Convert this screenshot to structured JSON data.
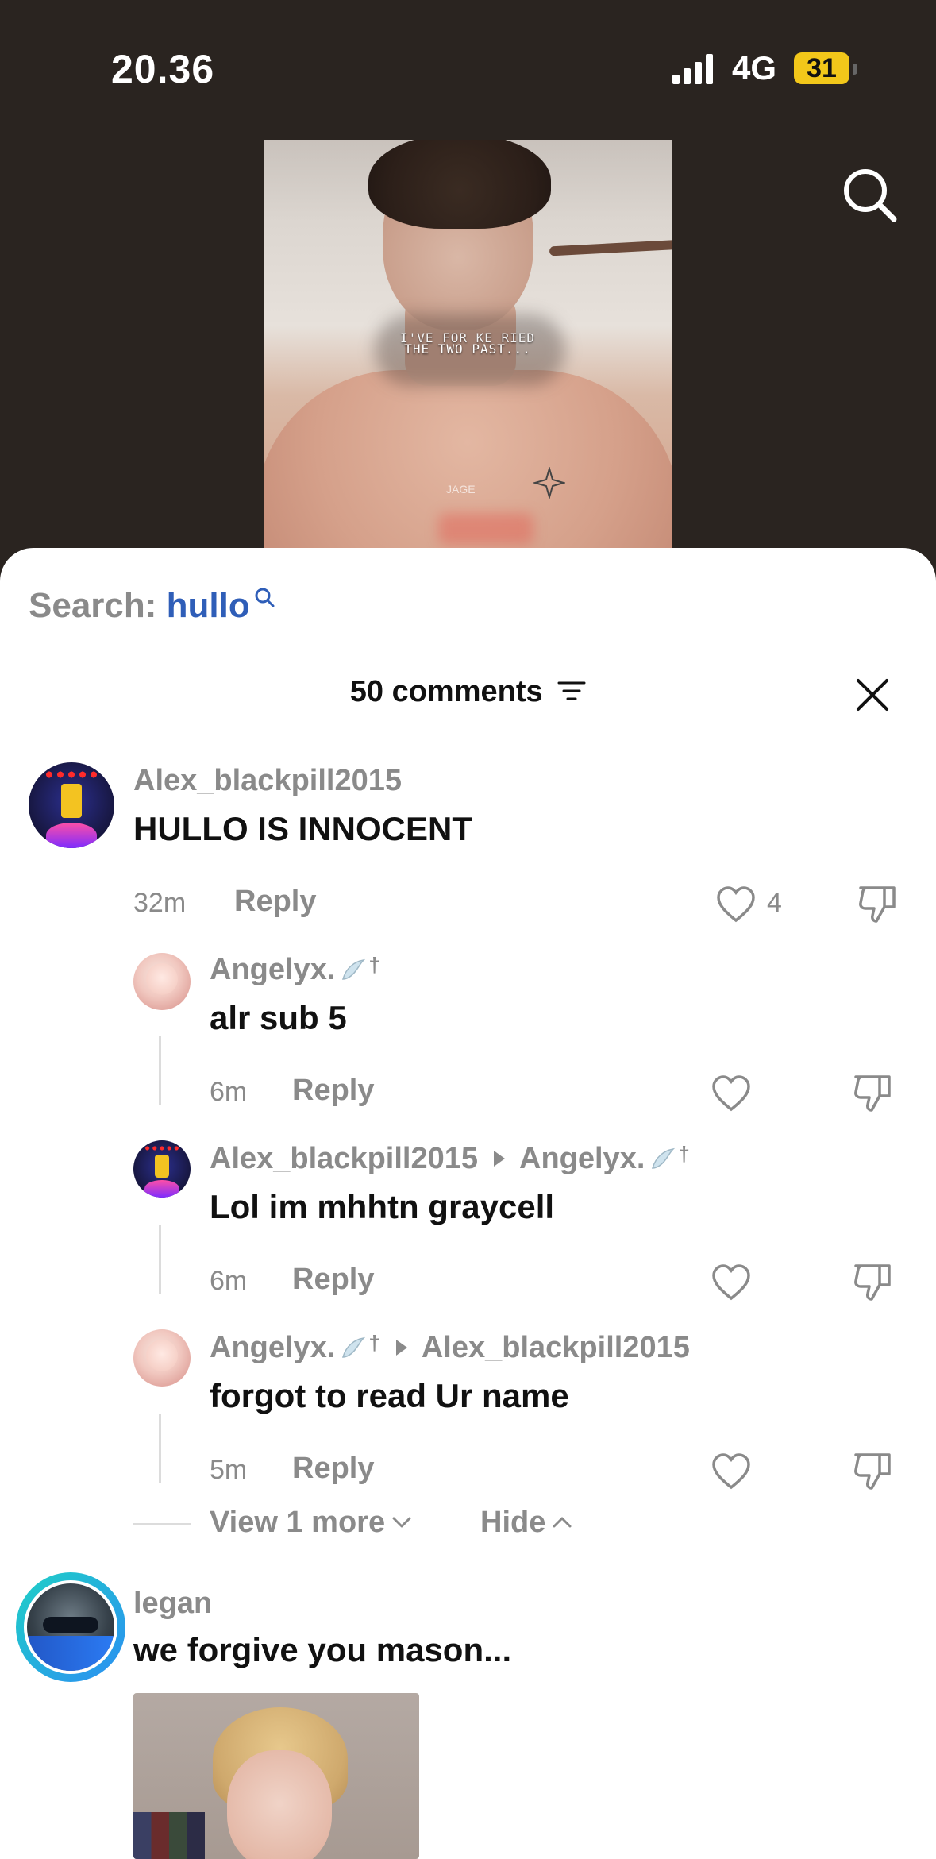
{
  "status_bar": {
    "time": "20.36",
    "network": "4G",
    "battery": "31"
  },
  "video": {
    "overlay_line1": "I'VE  FOR  KE  RIED",
    "overlay_line2": "THE TWO  PAST...",
    "tattoo_text": "JAGE"
  },
  "sheet": {
    "search_prefix": "Search:",
    "search_term": "hullo",
    "comments_count_label": "50 comments"
  },
  "comments": [
    {
      "username": "Alex_blackpill2015",
      "text": "HULLO IS INNOCENT",
      "age": "32m",
      "reply_label": "Reply",
      "likes": "4"
    },
    {
      "username": "Angelyx.",
      "text": "alr sub 5",
      "age": "6m",
      "reply_label": "Reply"
    },
    {
      "username": "Alex_blackpill2015",
      "reply_to": "Angelyx.",
      "text": "Lol im mhhtn graycell",
      "age": "6m",
      "reply_label": "Reply"
    },
    {
      "username": "Angelyx.",
      "reply_to": "Alex_blackpill2015",
      "text": "forgot to read Ur name",
      "age": "5m",
      "reply_label": "Reply"
    }
  ],
  "thread_controls": {
    "view_more": "View 1 more",
    "hide": "Hide"
  },
  "legan_comment": {
    "username": "legan",
    "text": "we forgive you mason..."
  },
  "icons": {
    "search_top": "search-icon",
    "sort": "sort-icon",
    "close": "close-icon",
    "like": "heart-icon",
    "dislike": "thumbs-down-icon",
    "wing": "wing-icon",
    "chevron_down": "chevron-down-icon",
    "chevron_up": "chevron-up-icon"
  },
  "colors": {
    "accent_search": "#2f5eb8",
    "battery": "#f2c71a",
    "legan_ring": "#1fd0c6"
  }
}
